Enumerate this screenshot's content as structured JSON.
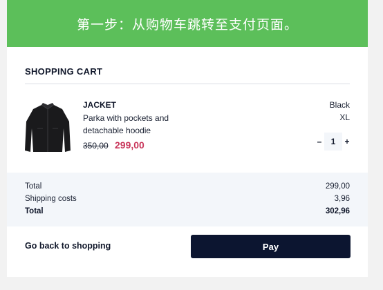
{
  "banner": {
    "text": "第一步：从购物车跳转至支付页面。"
  },
  "cart": {
    "title": "SHOPPING CART",
    "item": {
      "name": "JACKET",
      "description": "Parka with pockets and detachable hoodie",
      "price_old": "350,00",
      "price_new": "299,00",
      "color": "Black",
      "size": "XL",
      "quantity": "1",
      "decrement_label": "–",
      "increment_label": "+",
      "image_icon": "jacket-image"
    }
  },
  "summary": {
    "total_label": "Total",
    "total_value": "299,00",
    "shipping_label": "Shipping costs",
    "shipping_value": "3,96",
    "grand_total_label": "Total",
    "grand_total_value": "302,96"
  },
  "actions": {
    "back_label": "Go back to shopping",
    "pay_label": "Pay"
  },
  "colors": {
    "banner": "#5cbf5a",
    "sale_price": "#c9375b",
    "pay_button": "#0c1530",
    "summary_bg": "#f3f6fa"
  }
}
